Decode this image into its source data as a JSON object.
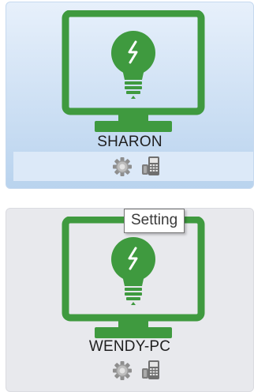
{
  "devices": [
    {
      "name": "SHARON",
      "state": "selected",
      "actions": [
        "gear-icon",
        "remote-icon"
      ]
    },
    {
      "name": "WENDY-PC",
      "state": "normal",
      "actions": [
        "gear-icon",
        "remote-icon"
      ]
    }
  ],
  "tooltip": {
    "text": "Setting"
  },
  "colors": {
    "monitor_green": "#3f9a3f",
    "selected_bg_top": "#e7f0fb",
    "selected_bg_bottom": "#b9d3ee",
    "normal_bg": "#e8e9ed"
  }
}
